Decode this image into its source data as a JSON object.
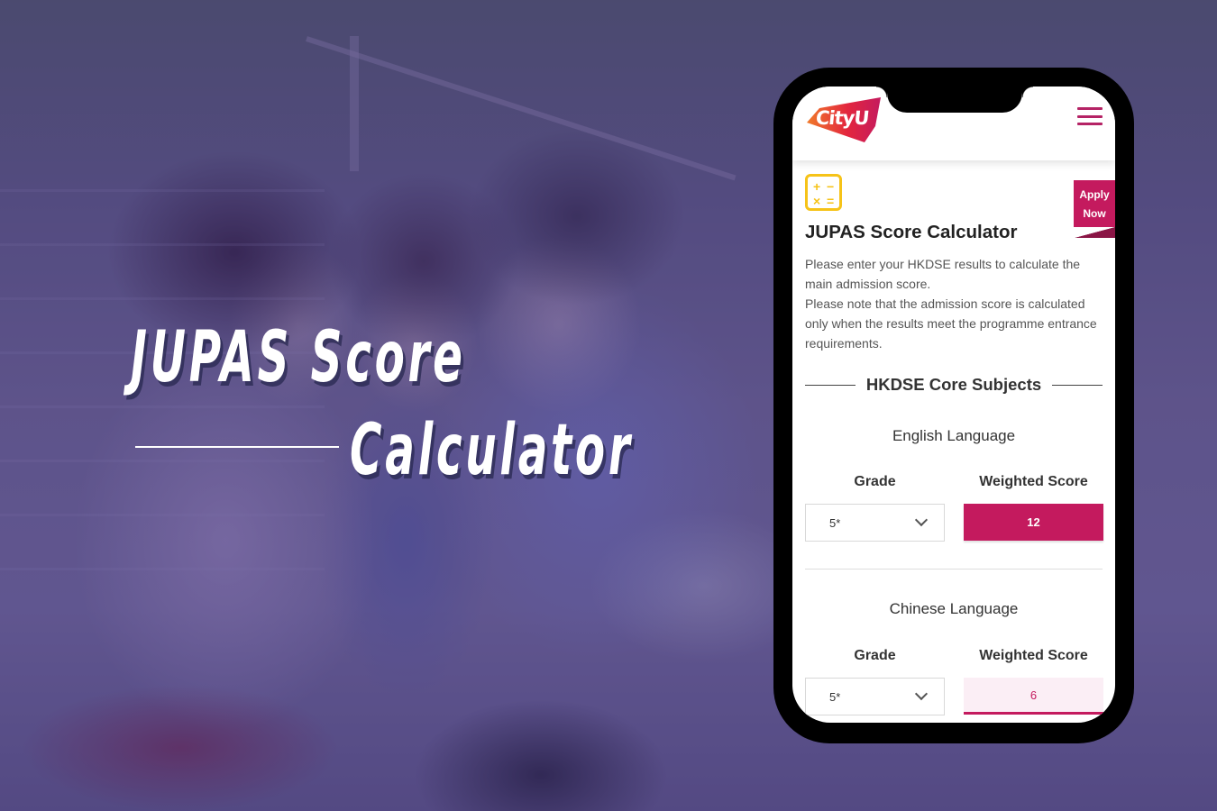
{
  "banner": {
    "headline_line1": "JUPAS Score",
    "headline_line2": "Calculator"
  },
  "phone": {
    "header": {
      "logo_text": "CityU",
      "menu_icon": "hamburger-menu-icon"
    },
    "apply_now": {
      "line1": "Apply",
      "line2": "Now"
    },
    "calculator_icon": {
      "glyphs": [
        "+",
        "−",
        "×",
        "="
      ]
    },
    "page_title": "JUPAS Score Calculator",
    "description": [
      "Please enter your HKDSE results to calculate the main admission score.",
      "Please note that the admission score is calculated only when the results meet the programme entrance requirements."
    ],
    "section_title": "HKDSE Core Subjects",
    "subjects": [
      {
        "name": "English Language",
        "grade_label": "Grade",
        "score_label": "Weighted Score",
        "grade_value": "5*",
        "weighted_score": "12"
      },
      {
        "name": "Chinese Language",
        "grade_label": "Grade",
        "score_label": "Weighted Score",
        "grade_value": "5*",
        "weighted_score": "6"
      }
    ]
  },
  "colors": {
    "brand_magenta": "#c41a5e",
    "icon_yellow": "#f6c318",
    "overlay_purple": "#483a82"
  }
}
